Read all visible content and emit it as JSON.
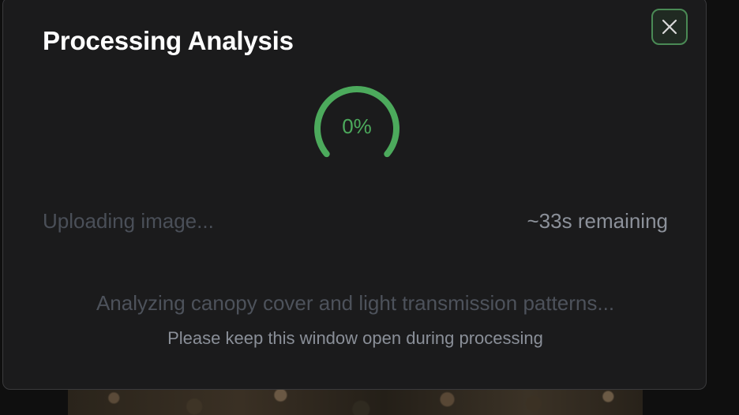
{
  "modal": {
    "title": "Processing Analysis",
    "close_icon": "close-icon",
    "progress": {
      "percent": 0,
      "label": "0%",
      "color": "#4caa5c"
    },
    "status": {
      "step": "Uploading image...",
      "eta": "~33s remaining"
    },
    "message": "Analyzing canopy cover and light transmission patterns...",
    "note": "Please keep this window open during processing"
  },
  "colors": {
    "accent": "#4caa5c",
    "surface": "#1b1b1c",
    "border": "#3a3a3c"
  }
}
